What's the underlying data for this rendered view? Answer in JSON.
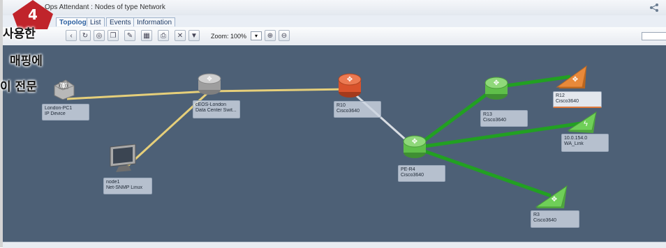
{
  "window": {
    "title": "Ops Attendant : Nodes of type Network"
  },
  "tabs": [
    {
      "label": "Topology"
    },
    {
      "label": "List"
    },
    {
      "label": "Events"
    },
    {
      "label": "Information"
    }
  ],
  "toolbar": {
    "zoom_label": "Zoom: 100%",
    "buttons": [
      "back-icon",
      "refresh-icon",
      "globe-icon",
      "copy-icon",
      "edit-icon",
      "layout-icon",
      "print-icon",
      "close-icon",
      "filter-icon",
      "zoom-in-icon",
      "zoom-out-icon"
    ]
  },
  "overlay": {
    "badge": "4",
    "line1": "사용한",
    "line2": "매핑에",
    "line3": "이 전문"
  },
  "nodes": [
    {
      "id": "london-pc1",
      "line1": "London-PC1",
      "line2": "IP Device",
      "type": "wireless-device",
      "color": "#9e9e9e"
    },
    {
      "id": "ceos-london",
      "line1": "cEOS-London",
      "line2": "Data Center Swit...",
      "type": "switch",
      "color": "#9e9e9e"
    },
    {
      "id": "node1",
      "line1": "node1",
      "line2": "Net-SNMP Linux",
      "type": "monitor",
      "color": "#9e9e9e"
    },
    {
      "id": "r10",
      "line1": "R10",
      "line2": "Cisco3640",
      "type": "router",
      "color": "#d9532c"
    },
    {
      "id": "pe-r4",
      "line1": "PE-R4",
      "line2": "Cisco3640",
      "type": "router",
      "color": "#5fbf4a"
    },
    {
      "id": "r13",
      "line1": "R13",
      "line2": "Cisco3640",
      "type": "router",
      "color": "#5fbf4a"
    },
    {
      "id": "r12",
      "line1": "R12",
      "line2": "Cisco3640",
      "type": "triangle-router",
      "color": "#e8893a"
    },
    {
      "id": "wa-link",
      "line1": "10.0.154.0",
      "line2": "WA_Link",
      "type": "triangle-link",
      "color": "#5fbf4a"
    },
    {
      "id": "r3",
      "line1": "R3",
      "line2": "Cisco3640",
      "type": "triangle-router",
      "color": "#5fbf4a"
    }
  ],
  "links": [
    {
      "from": "london-pc1",
      "to": "ceos-london",
      "color": "#e6cf7a"
    },
    {
      "from": "ceos-london",
      "to": "r10",
      "color": "#e6cf7a"
    },
    {
      "from": "ceos-london",
      "to": "node1",
      "color": "#e6cf7a"
    },
    {
      "from": "r10",
      "to": "pe-r4",
      "color": "#d9dde3"
    },
    {
      "from": "pe-r4",
      "to": "r13",
      "color": "#22a022"
    },
    {
      "from": "r13",
      "to": "r12",
      "color": "#22a022"
    },
    {
      "from": "pe-r4",
      "to": "wa-link",
      "color": "#22a022"
    },
    {
      "from": "pe-r4",
      "to": "r3",
      "color": "#22a022"
    }
  ]
}
